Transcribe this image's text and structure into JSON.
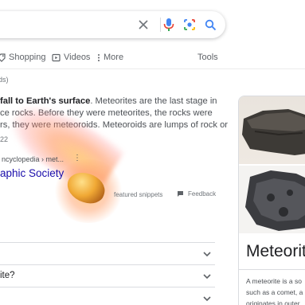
{
  "search": {
    "clear_icon": "close-icon",
    "mic_icon": "microphone-icon",
    "lens_icon": "camera-lens-icon",
    "search_icon": "search-icon"
  },
  "tabs": {
    "shopping": "Shopping",
    "videos": "Videos",
    "more": "More",
    "tools": "Tools"
  },
  "results_stats": "ds)",
  "snippet": {
    "line1_bold": "fall to Earth's surface",
    "line1_rest": ". Meteorites are the last stage in",
    "line2": "ce rocks. Before they were meteorites, the rocks were",
    "line3": "rs, they were meteoroids. Meteoroids are lumps of rock or",
    "date": "22"
  },
  "source": {
    "cite": "ncyclopedia › met...",
    "title": "aphic Society"
  },
  "snippet_footer": {
    "about": "featured snippets",
    "feedback": "Feedback"
  },
  "accordion": [
    {
      "text": ""
    },
    {
      "text": "ite?"
    },
    {
      "text": ""
    }
  ],
  "knowledge_panel": {
    "title": "Meteorite",
    "desc_line1": "A meteorite is a so",
    "desc_line2": "such as a comet, a",
    "desc_line3": "originates in outer"
  },
  "colors": {
    "link": "#1a0dab",
    "meteor": "#f0a834",
    "mic_blue": "#4285f4",
    "mic_red": "#ea4335"
  }
}
